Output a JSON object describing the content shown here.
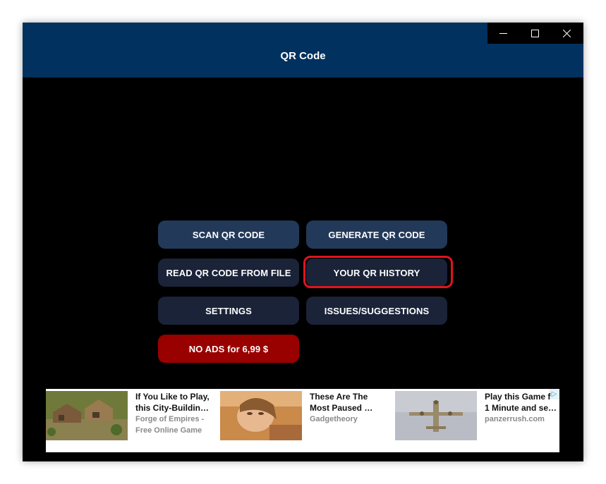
{
  "window": {
    "title": "QR Code",
    "controls": [
      "minimize-icon",
      "maximize-icon",
      "close-icon"
    ]
  },
  "menu": {
    "scan": "SCAN QR CODE",
    "generate": "GENERATE QR CODE",
    "read_file": "READ QR CODE FROM FILE",
    "history": "YOUR QR HISTORY",
    "settings": "SETTINGS",
    "issues": "ISSUES/SUGGESTIONS",
    "no_ads": "NO ADS for 6,99 $"
  },
  "ads": [
    {
      "headline_1": "If You Like to Play,",
      "headline_2": "this City-Buildin…",
      "source_1": "Forge of Empires -",
      "source_2": "Free Online Game"
    },
    {
      "headline_1": "These Are The",
      "headline_2": "Most Paused …",
      "source_1": "Gadgetheory",
      "source_2": ""
    },
    {
      "headline_1": "Play this Game f",
      "headline_2": "1 Minute and se…",
      "source_1": "panzerrush.com",
      "source_2": ""
    }
  ],
  "colors": {
    "titlebar": "#00315f",
    "button_blue": "#233959",
    "button_dark": "#1a2338",
    "button_red": "#990000",
    "highlight": "#e0141e"
  }
}
